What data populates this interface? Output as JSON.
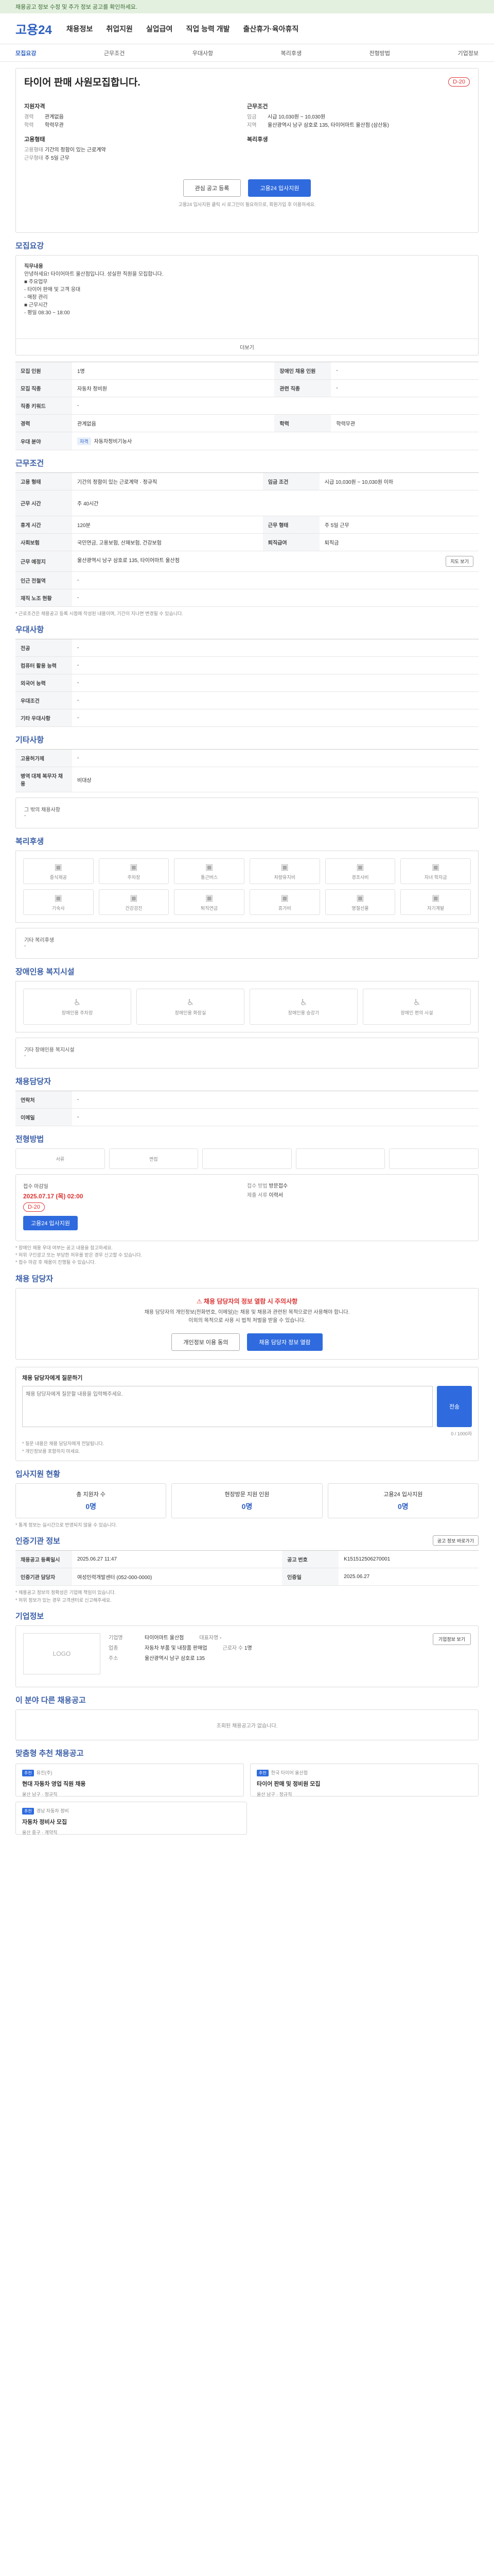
{
  "banner": "채용공고 정보 수정 및 추가 정보 공고를 확인하세요.",
  "site": {
    "logo": "고용24",
    "nav": [
      "채용정보",
      "취업지원",
      "실업급여",
      "직업 능력 개발",
      "출산휴가·육아휴직"
    ]
  },
  "tabs": [
    "모집요강",
    "근무조건",
    "우대사항",
    "복리후생",
    "전형방법",
    "기업정보"
  ],
  "job": {
    "title": "타이어 판매 사원모집합니다.",
    "dday": "D-20",
    "left_title": "지원자격",
    "right_title": "근무조건",
    "left": [
      {
        "k": "경력",
        "v": "관계없음"
      },
      {
        "k": "학력",
        "v": "학력무관"
      }
    ],
    "right": [
      {
        "k": "임금",
        "v": "시급 10,030원 ~ 10,030원"
      },
      {
        "k": "지역",
        "v": "울산광역시 남구 삼호로 135, 타이어마트 울산점 (삼산동)"
      }
    ],
    "left2_title": "고용형태",
    "right2_title": "복리후생",
    "left2": [
      {
        "k": "고용형태",
        "v": "기간의 정함이 있는 근로계약"
      },
      {
        "k": "근무형태",
        "v": "주 5일 근무"
      }
    ],
    "interest_btn": "관심 공고 등록",
    "apply_btn": "고용24 입사지원",
    "notice": "고용24 입사지원 클릭 시 로그인이 필요하므로, 회원가입 후 이용하세요."
  },
  "recruit": {
    "title": "모집요강",
    "body": [
      "직무내용",
      "안녕하세요! 타이어마트 울산점입니다. 성실한 직원을 모집합니다.",
      "■ 주요업무",
      "- 타이어 판매 및 고객 응대",
      "- 매장 관리",
      "■ 근무시간",
      "- 평일 08:30 ~ 18:00"
    ],
    "more": "더보기",
    "rows": [
      [
        "모집 인원",
        "1명",
        "장애인 채용 인원",
        "-"
      ],
      [
        "모집 직종",
        "자동차 정비원",
        "관련 직종",
        "-"
      ],
      [
        "직종 키워드",
        "-",
        "",
        ""
      ],
      [
        "경력",
        "관계없음",
        "학력",
        "학력무관"
      ],
      [
        "우대 분야",
        "",
        "",
        ""
      ]
    ],
    "pref_tag": "자격",
    "pref_val": "자동차정비기능사"
  },
  "work": {
    "title": "근무조건",
    "rows": [
      [
        "고용 형태",
        "기간의 정함이 있는 근로계약 · 정규직",
        "임금 조건",
        "시급 10,030원 ~ 10,030원 이하"
      ],
      [
        "근무 시간",
        "주 40시간",
        "",
        ""
      ],
      [
        "휴게 시간",
        "120분",
        "근무 형태",
        "주 5일 근무"
      ],
      [
        "사회보험",
        "국민연금, 고용보험, 산재보험, 건강보험",
        "퇴직급여",
        "퇴직금"
      ],
      [
        "근무 예정지",
        "울산광역시 남구 삼호로 135, 타이어마트 울산점",
        "",
        ""
      ],
      [
        "인근 전철역",
        "-",
        "",
        ""
      ],
      [
        "재직 노조 현황",
        "-",
        "",
        ""
      ]
    ],
    "map_btn": "지도 보기",
    "note": "* 근로조건은 채용공고 등록 시점에 작성된 내용이며, 기간이 지나면 변경될 수 있습니다."
  },
  "pref": {
    "title": "우대사항",
    "rows": [
      [
        "전공",
        "-"
      ],
      [
        "컴퓨터 활용 능력",
        "-"
      ],
      [
        "외국어 능력",
        "-"
      ],
      [
        "우대조건",
        "-"
      ],
      [
        "기타 우대사항",
        "-"
      ]
    ]
  },
  "etc": {
    "title": "기타사항",
    "rows": [
      [
        "고용허가제",
        "-"
      ],
      [
        "병역 대체 복무자 채용",
        "비대상"
      ]
    ],
    "extra_label": "그 밖의 채용사항",
    "extra_value": "-"
  },
  "welfare": {
    "title": "복리후생",
    "items": [
      "중식제공",
      "주차장",
      "통근버스",
      "차량유지비",
      "경조사비",
      "자녀 학자금",
      "기숙사",
      "건강검진",
      "퇴직연금",
      "휴가비",
      "명절선물",
      "자기계발"
    ],
    "extra_label": "기타 복리후생",
    "extra_value": "-"
  },
  "disab": {
    "title": "장애인용 복지시설",
    "items": [
      "장애인용 주차장",
      "장애인용 화장실",
      "장애인용 승강기",
      "장애인 편의 시설"
    ],
    "extra_label": "기타 장애인용 복지시설",
    "extra_value": "-"
  },
  "manager": {
    "title": "채용담당자",
    "rows": [
      [
        "연락처",
        "-",
        "",
        ""
      ],
      [
        "이메일",
        "-",
        "",
        ""
      ]
    ]
  },
  "process": {
    "title": "전형방법",
    "steps": [
      "서류",
      "면접",
      "",
      "",
      ""
    ],
    "rows": [
      [
        "접수 마감일",
        "2025.07.17 (목) 02:00",
        "접수 방법",
        "방문접수"
      ]
    ],
    "apply_btn": "고용24 입사지원",
    "deadline": "D-20",
    "docs_label": "제출 서류",
    "docs_value": "이력서",
    "notes": [
      "* 장애인 채용 우대 여부는 공고 내용을 참고하세요.",
      "* 허위 구인광고 또는 부당한 처우를 받은 경우 신고할 수 있습니다.",
      "* 접수 마감 후 채용이 진행될 수 있습니다."
    ]
  },
  "alert": {
    "title": "채용 담당자",
    "warn": "채용 담당자의 정보 열람 시 주의사항",
    "text": [
      "채용 담당자의 개인정보(전화번호, 이메일)는 채용 및 채용과 관련된 목적으로만 사용해야 합니다.",
      "이외의 목적으로 사용 시 법적 처벌을 받을 수 있습니다."
    ],
    "btn1": "개인정보 이용 동의",
    "btn2": "채용 담당자 정보 열람"
  },
  "question": {
    "title": "채용 담당자에게 질문하기",
    "placeholder": "채용 담당자에게 질문할 내용을 입력해주세요.",
    "counter": "0 / 1000자",
    "submit": "전송",
    "notes": [
      "* 질문 내용은 채용 담당자에게 전달됩니다.",
      "* 개인정보를 포함하지 마세요."
    ]
  },
  "stats": {
    "title": "입사지원 현황",
    "cards": [
      {
        "k": "총 지원자 수",
        "v": "0명"
      },
      {
        "k": "현장방문 지원 인원",
        "v": "0명"
      },
      {
        "k": "고용24 입사지원",
        "v": "0명"
      }
    ],
    "note": "* 통계 정보는 실시간으로 반영되지 않을 수 있습니다."
  },
  "hire": {
    "title": "인증기관 정보",
    "link": "공고 정보 바로가기",
    "rows": [
      [
        "채용공고 등록일시",
        "2025.06.27 11:47",
        "공고 번호",
        "K151512506270001"
      ],
      [
        "인증기관 담당자",
        "여성인력개발센터 (052-000-0000)",
        "인증일",
        "2025.06.27"
      ]
    ],
    "notes": [
      "* 채용공고 정보의 정확성은 기업에 책임이 있습니다.",
      "* 허위 정보가 있는 경우 고객센터로 신고해주세요."
    ]
  },
  "company": {
    "title": "기업정보",
    "logo_text": "LOGO",
    "rows": [
      [
        "기업명",
        "타이어마트 울산점",
        "대표자명",
        "-"
      ],
      [
        "업종",
        "자동차 부품 및 내장품 판매업",
        "근로자 수",
        "1명"
      ],
      [
        "주소",
        "울산광역시 남구 삼호로 135",
        "",
        ""
      ]
    ],
    "btn": "기업정보 보기"
  },
  "related": {
    "title": "이 분야 다른 채용공고",
    "empty": "조회된 채용공고가 없습니다."
  },
  "recommend": {
    "title": "맞춤형 추천 채용공고",
    "items": [
      {
        "badge": "추천",
        "sub": "유진(주)",
        "name": "현대 자동차 영업 직원 채용",
        "meta": "울산 남구 · 정규직"
      },
      {
        "badge": "추천",
        "sub": "한국 타이어 울산점",
        "name": "타이어 판매 및 정비원 모집",
        "meta": "울산 남구 · 정규직"
      },
      {
        "badge": "추천",
        "sub": "경남 자동차 정비",
        "name": "자동차 정비사 모집",
        "meta": "울산 중구 · 계약직"
      }
    ]
  }
}
